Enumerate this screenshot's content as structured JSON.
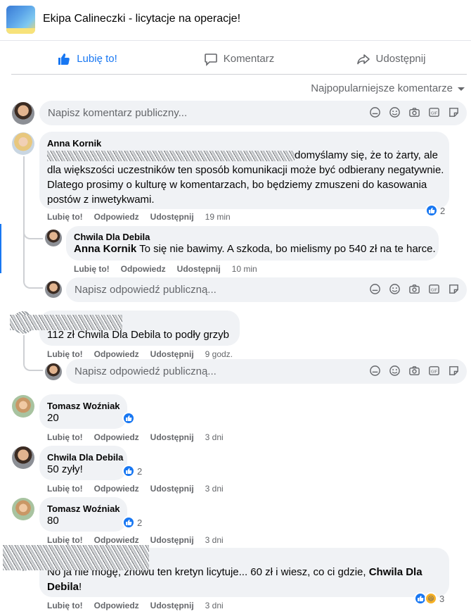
{
  "header": {
    "group_title": "Ekipa Calineczki - licytacje na operacje!"
  },
  "actions": {
    "like": "Lubię to!",
    "comment": "Komentarz",
    "share": "Udostępnij",
    "liked_color": "#1877f2"
  },
  "sort": {
    "label": "Najpopularniejsze komentarze"
  },
  "composer": {
    "placeholder": "Napisz komentarz publiczny..."
  },
  "reply_composer": {
    "placeholder": "Napisz odpowiedź publiczną..."
  },
  "meta_labels": {
    "like": "Lubię to!",
    "reply": "Odpowiedz",
    "share": "Udostępnij"
  },
  "comments": [
    {
      "author": "Anna Kornik",
      "text_lines": [
        "domyślamy się, że to żarty, ale",
        "dla większości uczestników ten sposób komunikacji może być odbierany negatywnie.",
        "Dlatego prosimy o kulturę w komentarzach, bo będziemy zmuszeni do kasowania",
        "postów z inwetykwami."
      ],
      "time": "19 min",
      "reaction_count": "2"
    },
    {
      "author": "Chwila Dla Debila",
      "mention": "Anna Kornik",
      "text": " To się nie bawimy. A szkoda, bo mielismy po 540 zł na te harce.",
      "time": "10 min"
    },
    {
      "author": "",
      "text": "112 zł Chwila Dla Debila to podły grzyb",
      "time": "9 godz."
    },
    {
      "author": "Tomasz Woźniak",
      "text": "20",
      "time": "3 dni"
    },
    {
      "author": "Chwila Dla Debila",
      "text": "50 zyły!",
      "time": "3 dni",
      "reaction_count": "2"
    },
    {
      "author": "Tomasz Woźniak",
      "text": "80",
      "time": "3 dni",
      "reaction_count": "2"
    },
    {
      "author": "",
      "text": "No ja nie mogę, znowu ten kretyn licytuje... 60 zł i wiesz, co ci gdzie, ",
      "mention": "Chwila Dla",
      "mention_2": "Debila",
      "tail": "!",
      "time": "3 dni",
      "reaction_count": "3"
    }
  ]
}
